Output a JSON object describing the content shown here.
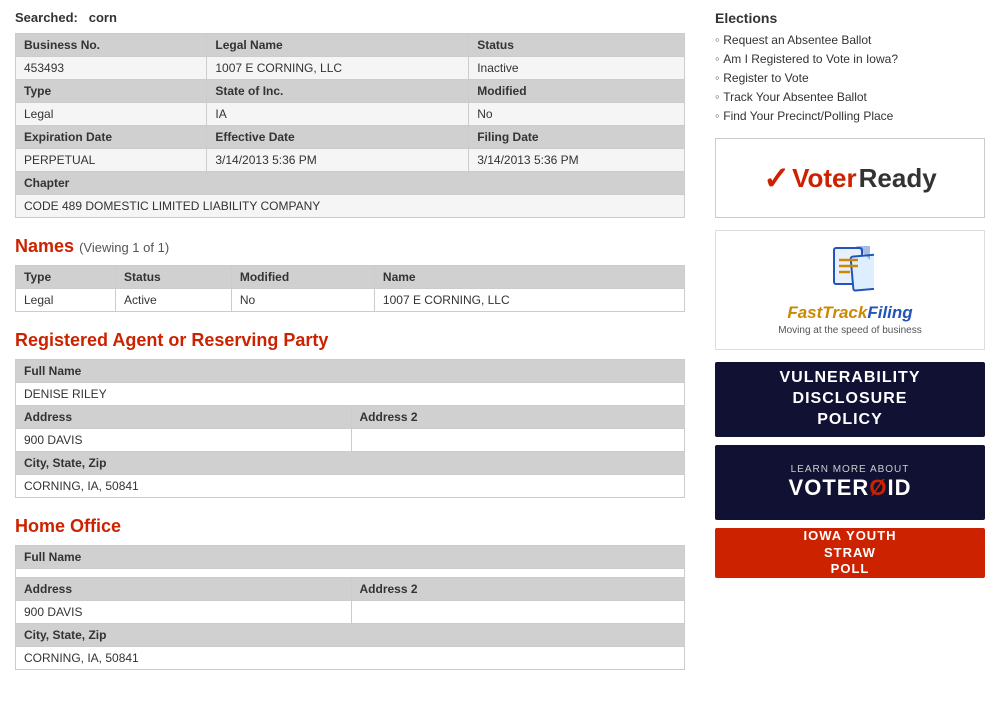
{
  "searched": {
    "label": "Searched:",
    "term": "corn"
  },
  "business": {
    "headers": {
      "biz_no": "Business No.",
      "legal_name": "Legal Name",
      "status": "Status",
      "type": "Type",
      "state_of_inc": "State of Inc.",
      "modified": "Modified",
      "exp_date": "Expiration Date",
      "eff_date": "Effective Date",
      "filing_date": "Filing Date",
      "chapter": "Chapter"
    },
    "row1": {
      "biz_no": "453493",
      "legal_name": "1007 E CORNING, LLC",
      "status": "Inactive"
    },
    "row2": {
      "type": "Legal",
      "state_of_inc": "IA",
      "modified": "No"
    },
    "row3": {
      "exp_date": "PERPETUAL",
      "eff_date": "3/14/2013 5:36 PM",
      "filing_date": "3/14/2013 5:36 PM"
    },
    "chapter_value": "CODE 489 DOMESTIC LIMITED LIABILITY COMPANY"
  },
  "names_section": {
    "title": "Names",
    "viewing": "(Viewing 1 of 1)",
    "headers": {
      "type": "Type",
      "status": "Status",
      "modified": "Modified",
      "name": "Name"
    },
    "row1": {
      "type": "Legal",
      "status": "Active",
      "modified": "No",
      "name": "1007 E CORNING, LLC"
    }
  },
  "agent_section": {
    "title": "Registered Agent or Reserving Party",
    "full_name_label": "Full Name",
    "full_name_value": "DENISE RILEY",
    "address_label": "Address",
    "address2_label": "Address 2",
    "address_value": "900 DAVIS",
    "city_state_zip_label": "City, State, Zip",
    "city_state_zip_value": "CORNING, IA, 50841"
  },
  "home_office_section": {
    "title": "Home Office",
    "full_name_label": "Full Name",
    "full_name_value": "",
    "address_label": "Address",
    "address2_label": "Address 2",
    "address_value": "900 DAVIS",
    "city_state_zip_label": "City, State, Zip",
    "city_state_zip_value": "CORNING, IA, 50841"
  },
  "sidebar": {
    "elections_title": "Elections",
    "elections_links": [
      "Request an Absentee Ballot",
      "Am I Registered to Vote in Iowa?",
      "Register to Vote",
      "Track Your Absentee Ballot",
      "Find Your Precinct/Polling Place"
    ],
    "voter_ready": {
      "check": "✓",
      "voter": "Voter",
      "ready": "Ready"
    },
    "fast_track": {
      "fast": "Fast",
      "track": "Track",
      "filing": "Filing",
      "subtitle": "Moving at the speed of business"
    },
    "vuln": {
      "line1": "VULNERABILITY",
      "line2": "DISCLOSURE",
      "line3": "POLICY"
    },
    "voteroid": {
      "learn": "LEARN MORE ABOUT",
      "title_pre": "VOTER",
      "title_o": "Ø",
      "title_post": "ID"
    },
    "straw_poll": {
      "line1": "IOWA YOUTH",
      "line2": "STRAW",
      "line3": "POLL"
    }
  }
}
